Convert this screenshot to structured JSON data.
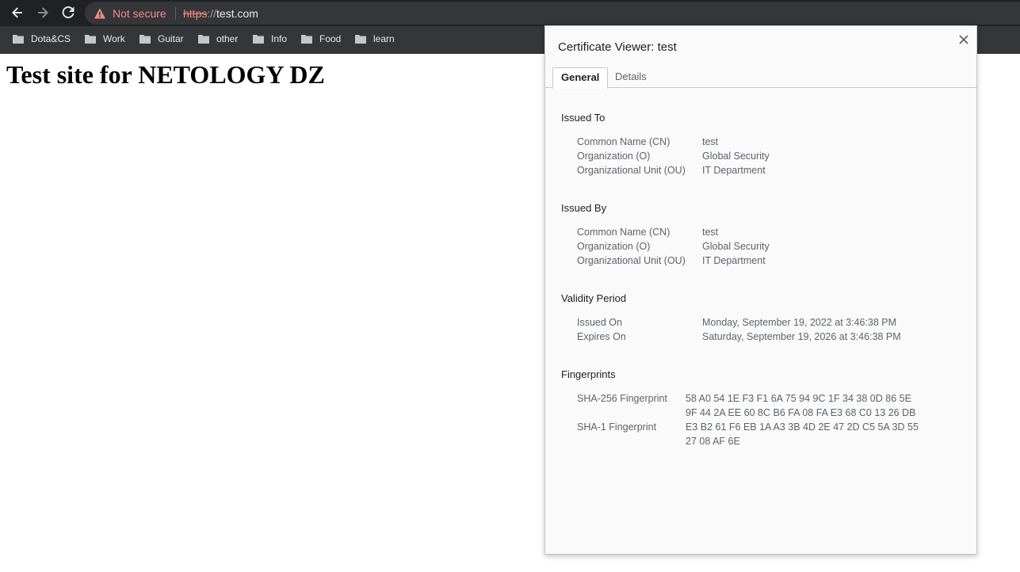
{
  "browser": {
    "security_label": "Not secure",
    "url_scheme": "https",
    "url_separator": "://",
    "url_host": "test.com",
    "colors": {
      "toolbar_bg": "#202124",
      "bookmarks_bg": "#35363a",
      "warning": "#f28b82"
    }
  },
  "bookmarks": [
    {
      "label": "Dota&CS",
      "icon": "folder-icon"
    },
    {
      "label": "Work",
      "icon": "folder-icon"
    },
    {
      "label": "Guitar",
      "icon": "folder-icon"
    },
    {
      "label": "other",
      "icon": "folder-icon"
    },
    {
      "label": "Info",
      "icon": "folder-icon"
    },
    {
      "label": "Food",
      "icon": "folder-icon"
    },
    {
      "label": "learn",
      "icon": "folder-icon"
    }
  ],
  "page": {
    "heading": "Test site for NETOLOGY DZ"
  },
  "dialog": {
    "title": "Certificate Viewer: test",
    "tabs": [
      {
        "label": "General",
        "active": true
      },
      {
        "label": "Details",
        "active": false
      }
    ],
    "issued_to": {
      "title": "Issued To",
      "rows": [
        {
          "label": "Common Name (CN)",
          "value": "test"
        },
        {
          "label": "Organization (O)",
          "value": "Global Security"
        },
        {
          "label": "Organizational Unit (OU)",
          "value": "IT Department"
        }
      ]
    },
    "issued_by": {
      "title": "Issued By",
      "rows": [
        {
          "label": "Common Name (CN)",
          "value": "test"
        },
        {
          "label": "Organization (O)",
          "value": "Global Security"
        },
        {
          "label": "Organizational Unit (OU)",
          "value": "IT Department"
        }
      ]
    },
    "validity": {
      "title": "Validity Period",
      "rows": [
        {
          "label": "Issued On",
          "value": "Monday, September 19, 2022 at 3:46:38 PM"
        },
        {
          "label": "Expires On",
          "value": "Saturday, September 19, 2026 at 3:46:38 PM"
        }
      ]
    },
    "fingerprints": {
      "title": "Fingerprints",
      "rows": [
        {
          "label": "SHA-256 Fingerprint",
          "line1": "58 A0 54 1E F3 F1 6A 75 94 9C 1F 34 38 0D 86 5E",
          "line2": "9F 44 2A EE 60 8C B6 FA 08 FA E3 68 C0 13 26 DB"
        },
        {
          "label": "SHA-1 Fingerprint",
          "line1": "E3 B2 61 F6 EB 1A A3 3B 4D 2E 47 2D C5 5A 3D 55",
          "line2": "27 08 AF 6E"
        }
      ]
    }
  }
}
